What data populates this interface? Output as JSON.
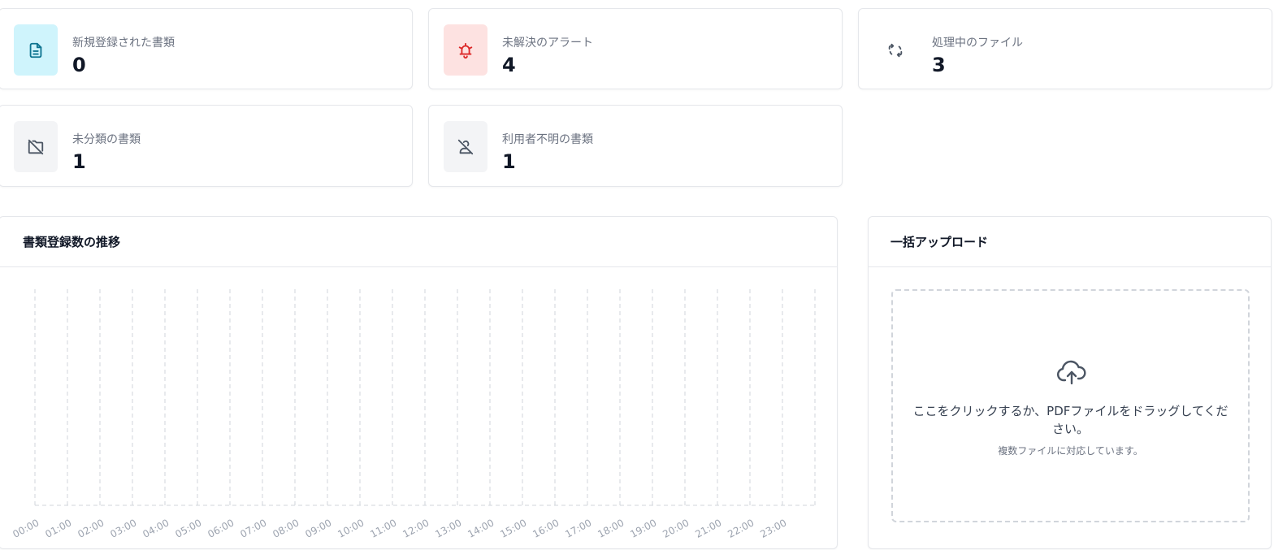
{
  "stats": [
    {
      "label": "新規登録された書類",
      "value": "0",
      "icon": "document-icon",
      "bg": "#cff4fc",
      "fg": "#0e7490"
    },
    {
      "label": "未解決のアラート",
      "value": "4",
      "icon": "alarm-bell-icon",
      "bg": "#fde2e1",
      "fg": "#dc2626"
    },
    {
      "label": "処理中のファイル",
      "value": "3",
      "icon": "refresh-icon",
      "bg": "#ffffff",
      "fg": "#4b5563"
    },
    {
      "label": "未分類の書類",
      "value": "1",
      "icon": "folder-off-icon",
      "bg": "#f3f4f6",
      "fg": "#4b5563"
    },
    {
      "label": "利用者不明の書類",
      "value": "1",
      "icon": "user-off-icon",
      "bg": "#f3f4f6",
      "fg": "#4b5563"
    }
  ],
  "chart_panel": {
    "title": "書類登録数の推移"
  },
  "upload_panel": {
    "title": "一括アップロード",
    "dropzone_text": "ここをクリックするか、PDFファイルをドラッグしてください。",
    "dropzone_hint": "複数ファイルに対応しています。",
    "icon": "cloud-upload-icon"
  },
  "chart_data": {
    "type": "bar",
    "categories": [
      "00:00",
      "01:00",
      "02:00",
      "03:00",
      "04:00",
      "05:00",
      "06:00",
      "07:00",
      "08:00",
      "09:00",
      "10:00",
      "11:00",
      "12:00",
      "13:00",
      "14:00",
      "15:00",
      "16:00",
      "17:00",
      "18:00",
      "19:00",
      "20:00",
      "21:00",
      "22:00",
      "23:00"
    ],
    "values": [
      0,
      0,
      0,
      0,
      0,
      0,
      0,
      0,
      0,
      0,
      0,
      0,
      0,
      0,
      0,
      0,
      0,
      0,
      0,
      0,
      0,
      0,
      0,
      0
    ],
    "grid": "vertical dashed"
  }
}
